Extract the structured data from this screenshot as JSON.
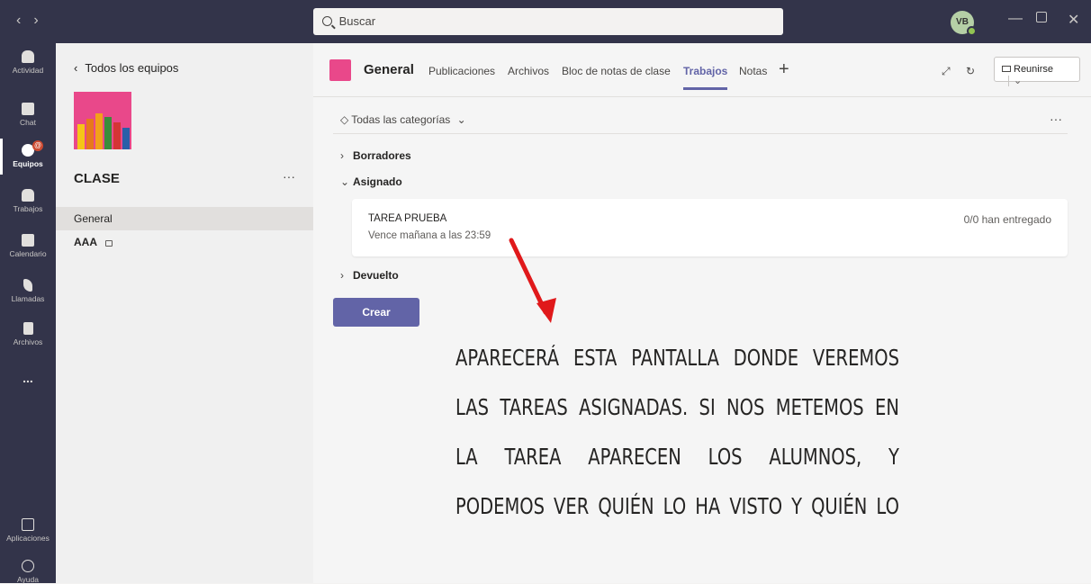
{
  "titlebar": {
    "search_placeholder": "Buscar",
    "avatar_initials": "VB"
  },
  "rail": {
    "items": [
      {
        "label": "Actividad",
        "icon": "bell-icon"
      },
      {
        "label": "Chat",
        "icon": "chat-icon"
      },
      {
        "label": "Equipos",
        "icon": "teams-icon",
        "badge": "@"
      },
      {
        "label": "Trabajos",
        "icon": "backpack-icon"
      },
      {
        "label": "Calendario",
        "icon": "calendar-icon"
      },
      {
        "label": "Llamadas",
        "icon": "phone-icon"
      },
      {
        "label": "Archivos",
        "icon": "file-icon"
      },
      {
        "label": "...",
        "icon": "more-icon"
      }
    ],
    "bottom": [
      {
        "label": "Aplicaciones",
        "icon": "apps-icon"
      },
      {
        "label": "Ayuda",
        "icon": "help-icon"
      }
    ]
  },
  "teams_panel": {
    "back_label": "Todos los equipos",
    "team_name": "CLASE",
    "more": "···",
    "channels": [
      {
        "label": "General"
      },
      {
        "label": "AAA"
      }
    ]
  },
  "header": {
    "channel": "General",
    "tabs": [
      "Publicaciones",
      "Archivos",
      "Bloc de notas de clase",
      "Trabajos",
      "Notas"
    ],
    "active_tab": "Trabajos",
    "meet_label": "Reunirse"
  },
  "assignments": {
    "filter": "Todas las categorías",
    "more": "···",
    "sections": {
      "drafts": "Borradores",
      "assigned": "Asignado",
      "returned": "Devuelto"
    },
    "card": {
      "title": "TAREA PRUEBA",
      "due": "Vence mañana a las 23:59",
      "count": "0/0 han entregado"
    },
    "create_label": "Crear"
  },
  "annotation": {
    "lines": [
      "APARECERÁ ESTA PANTALLA DONDE VEREMOS",
      "LAS TAREAS ASIGNADAS. SI NOS METEMOS EN",
      "LA TAREA APARECEN LOS ALUMNOS, Y",
      "PODEMOS VER QUIÉN LO HA VISTO Y QUIÉN LO"
    ],
    "arrow_color": "#e0191b"
  },
  "colors": {
    "accent": "#6264a7",
    "titlebar": "#33344a",
    "team_image": "#e9488a"
  }
}
